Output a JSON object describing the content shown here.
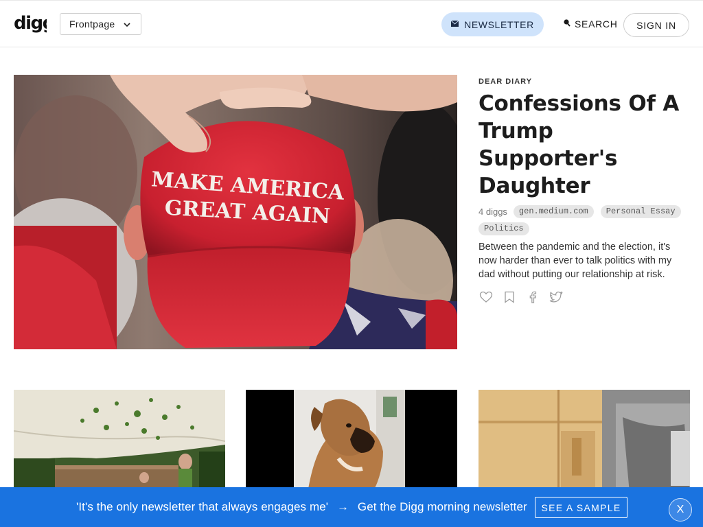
{
  "header": {
    "logo_text": "digg",
    "section_select": {
      "selected": "Frontpage",
      "icon": "chevron-down-icon"
    },
    "newsletter_label": "NEWSLETTER",
    "search_label": "SEARCH",
    "signin_label": "SIGN IN"
  },
  "hero": {
    "image_text": [
      "MAKE AMERICA",
      "GREAT AGAIN"
    ],
    "kicker": "DEAR DIARY",
    "headline": "Confessions Of A Trump Supporter's Daughter",
    "diggs": "4 diggs",
    "tags": [
      "gen.medium.com",
      "Personal Essay",
      "Politics"
    ],
    "description": "Between the pandemic and the election, it's now harder than ever to talk politics with my dad without putting our relationship at risk.",
    "actions": [
      "heart-icon",
      "bookmark-icon",
      "facebook-icon",
      "twitter-icon"
    ]
  },
  "thumbnails": [
    {
      "name": "thumbnail-forest-camp"
    },
    {
      "name": "thumbnail-boxer-dog"
    },
    {
      "name": "thumbnail-wooden-cabinet"
    }
  ],
  "banner": {
    "quote": "'It's the only newsletter that always engages me'",
    "arrow": "→",
    "cta_text": "Get the Digg morning newsletter",
    "button_label": "SEE A SAMPLE",
    "close_label": "X"
  },
  "colors": {
    "banner_bg": "#1a73e0",
    "newsletter_pill_bg": "#cfe3fb",
    "tag_bg": "#e6e6e6",
    "cap_red": "#d4263a"
  }
}
